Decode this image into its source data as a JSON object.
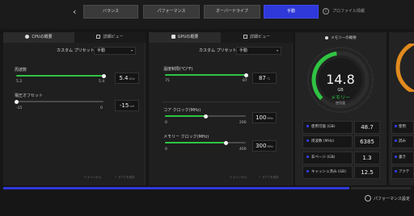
{
  "topbar": {
    "tabs": [
      "バランス",
      "パフォーマンス",
      "オーバードライブ",
      "手動"
    ],
    "help_label": "プロファイル情報"
  },
  "cpu_panel": {
    "tab_overview": "CPUの概要",
    "tab_detail": "詳細ビュー",
    "preset_label": "カスタム プリセット",
    "preset_value": "手動",
    "freq_label": "周波数",
    "freq_min": "5.2",
    "freq_max": "5.4",
    "freq_value": "5.4",
    "freq_unit": "GHz",
    "freq_fill": 1.0,
    "volt_label": "電圧オフセット",
    "volt_min": "-15",
    "volt_max": "0",
    "volt_value": "-15",
    "volt_unit": "mV",
    "volt_fill": 0.0,
    "footer_cancel": "キャンセル",
    "footer_apply": "すべてを保存"
  },
  "gpu_panel": {
    "tab_overview": "GPUの概要",
    "tab_detail": "詳細ビュー",
    "preset_label": "カスタム プリセット",
    "preset_value": "手動",
    "temp_label": "温度制限(℃/°F)",
    "temp_min": "75",
    "temp_max": "87",
    "temp_value": "87",
    "temp_unit": "°C",
    "temp_fill": 1.0,
    "core_label": "コア クロック(MHz)",
    "core_min": "0",
    "core_max": "200",
    "core_value": "100",
    "core_unit": "MHz",
    "core_fill": 0.5,
    "memclk_label": "メモリー クロック(MHz)",
    "memclk_min": "0",
    "memclk_max": "400",
    "memclk_value": "300",
    "memclk_unit": "MHz",
    "memclk_fill": 0.75,
    "footer_cancel": "キャンセル",
    "footer_apply": "すべてを保存"
  },
  "memory_panel": {
    "title": "メモリーの概要",
    "gauge_value": "14.8",
    "gauge_unit": "GB",
    "gauge_name": "メモリー",
    "gauge_sub": "使用量",
    "gauge_fraction": 0.47,
    "stats": [
      {
        "label": "使用可能 (GB)",
        "value": "48.7"
      },
      {
        "label": "周波数 (MHz)",
        "value": "6385"
      },
      {
        "label": "非ページ (GB)",
        "value": "1.3"
      },
      {
        "label": "キャッシュ済み (GB)",
        "value": "12.5"
      }
    ]
  },
  "right_panel": {
    "rows": [
      "使用",
      "読み",
      "書き",
      "アクテ"
    ]
  },
  "bottom": {
    "perf_label": "パフォーマンス設定",
    "progress": 0.85
  },
  "colors": {
    "accent_blue": "#2f38d8",
    "slider_green": "#2fc443",
    "gauge_green": "#2fc443",
    "gauge_orange": "#e28a1e"
  }
}
